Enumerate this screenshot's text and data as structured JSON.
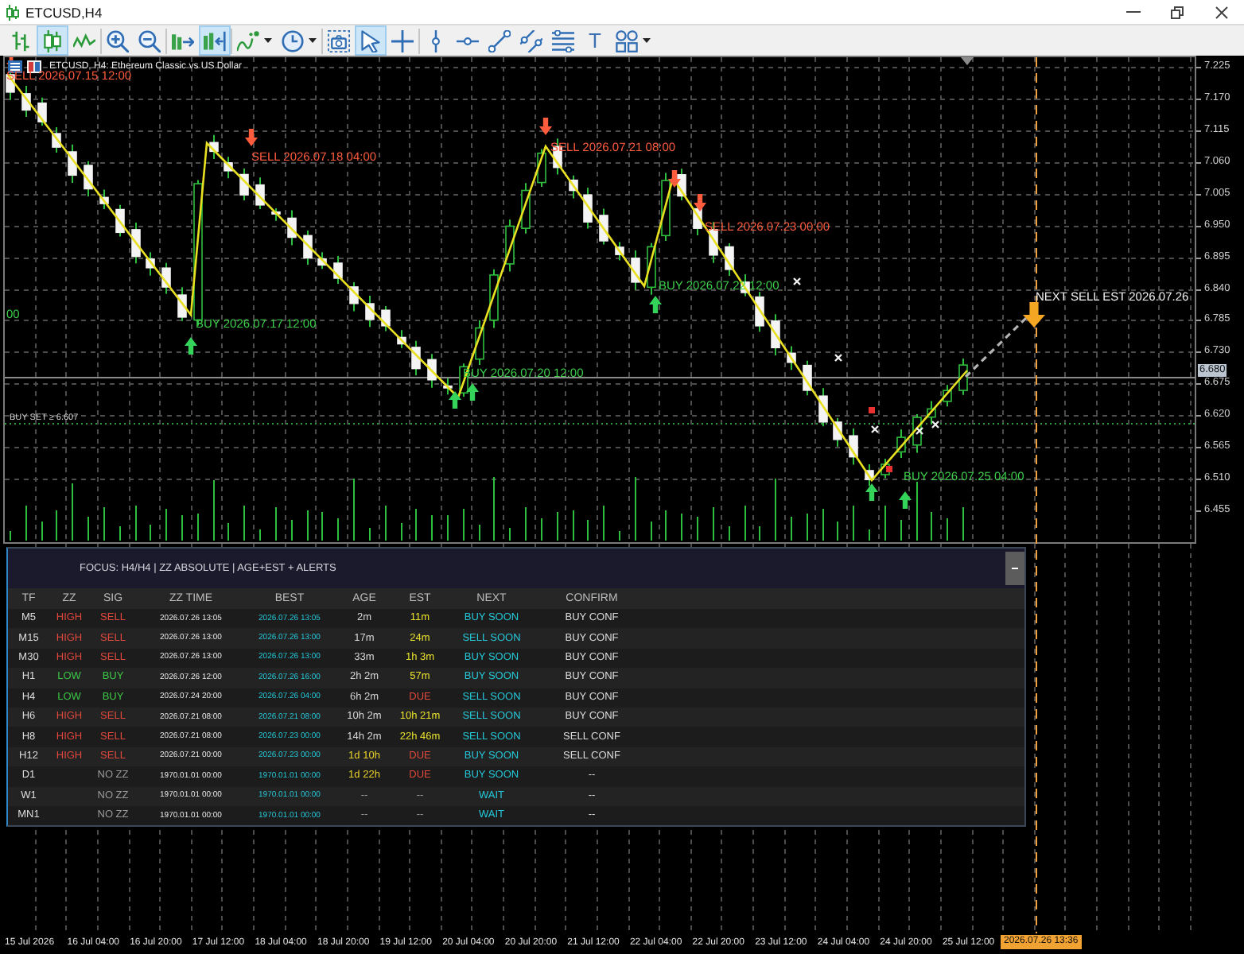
{
  "window": {
    "title": "ETCUSD,H4"
  },
  "toolbar": {
    "groups": [
      [
        {
          "kind": "bar-chart",
          "selected": false
        },
        {
          "kind": "candlesticks",
          "selected": true
        },
        {
          "kind": "line-chart",
          "selected": false
        }
      ],
      [
        {
          "kind": "zoom-in",
          "selected": false
        },
        {
          "kind": "zoom-out",
          "selected": false
        }
      ],
      [
        {
          "kind": "auto-scroll",
          "selected": false
        },
        {
          "kind": "chart-shift",
          "selected": true
        }
      ],
      [
        {
          "kind": "indicators",
          "selected": false
        },
        {
          "kind": "periods",
          "selected": false
        }
      ],
      [
        {
          "kind": "screenshot",
          "selected": false
        },
        {
          "kind": "cursor",
          "selected": true
        },
        {
          "kind": "crosshair",
          "selected": false
        }
      ],
      [
        {
          "kind": "vertical-line",
          "selected": false
        },
        {
          "kind": "horizontal-line",
          "selected": false
        },
        {
          "kind": "trendline",
          "selected": false
        },
        {
          "kind": "channel",
          "selected": false
        },
        {
          "kind": "fibonacci",
          "selected": false
        },
        {
          "kind": "text",
          "label": "T",
          "selected": false
        },
        {
          "kind": "shapes",
          "selected": false
        }
      ]
    ]
  },
  "chart": {
    "symbol": "ETCUSD, H4: Ethereum Classic vs US Dollar",
    "signals": [
      {
        "kind": "sell",
        "text": "SELL 2026.07.15 12:00"
      },
      {
        "kind": "buy",
        "text": "BUY 2026.07.17 12:00"
      },
      {
        "kind": "sell",
        "text": "SELL 2026.07.18 04:00"
      },
      {
        "kind": "buy",
        "text": "BUY 2026.07.20 12:00"
      },
      {
        "kind": "sell",
        "text": "SELL 2026.07.21 08:00"
      },
      {
        "kind": "buy",
        "text": "BUY 2026.07.22 12:00"
      },
      {
        "kind": "sell",
        "text": "SELL 2026.07.23 00:00"
      },
      {
        "kind": "buy",
        "text": "BUY 2026.07.25 04:00"
      }
    ],
    "forecast": "NEXT SELL EST 2026.07.26",
    "edge_label": "00",
    "level_label": "BUY SET ≥ 6.607",
    "price_axis": [
      "7.225",
      "7.170",
      "7.115",
      "7.060",
      "7.005",
      "6.950",
      "6.895",
      "6.840",
      "6.785",
      "6.730",
      "6.675",
      "6.620",
      "6.565",
      "6.510",
      "6.455"
    ],
    "current_price": "6.680",
    "time_axis": [
      "15 Jul 2026",
      "16 Jul 04:00",
      "16 Jul 20:00",
      "17 Jul 12:00",
      "18 Jul 04:00",
      "18 Jul 20:00",
      "19 Jul 12:00",
      "20 Jul 04:00",
      "20 Jul 20:00",
      "21 Jul 12:00",
      "22 Jul 04:00",
      "22 Jul 20:00",
      "23 Jul 12:00",
      "24 Jul 04:00",
      "24 Jul 20:00",
      "25 Jul 12:00"
    ],
    "current_time": "2026.07.26 13:36"
  },
  "panel": {
    "title": "FOCUS: H4/H4 | ZZ ABSOLUTE | AGE+EST + ALERTS",
    "columns": [
      "TF",
      "ZZ",
      "SIG",
      "ZZ TIME",
      "BEST",
      "AGE",
      "EST",
      "NEXT",
      "CONFIRM"
    ],
    "rows": [
      {
        "tf": "M5",
        "zz": {
          "text": "HIGH",
          "color": "#e2483c"
        },
        "sig": {
          "text": "SELL",
          "color": "#e2483c"
        },
        "zz_time": "2026.07.26 13:05",
        "best": "2026.07.26 13:05",
        "age": {
          "text": "2m",
          "color": "#d6d6d6"
        },
        "est": {
          "text": "11m",
          "color": "#e8e02c"
        },
        "next": "BUY SOON",
        "confirm": "BUY CONF"
      },
      {
        "tf": "M15",
        "zz": {
          "text": "HIGH",
          "color": "#e2483c"
        },
        "sig": {
          "text": "SELL",
          "color": "#e2483c"
        },
        "zz_time": "2026.07.26 13:00",
        "best": "2026.07.26 13:00",
        "age": {
          "text": "17m",
          "color": "#d6d6d6"
        },
        "est": {
          "text": "24m",
          "color": "#e8e02c"
        },
        "next": "SELL SOON",
        "confirm": "BUY CONF"
      },
      {
        "tf": "M30",
        "zz": {
          "text": "HIGH",
          "color": "#e2483c"
        },
        "sig": {
          "text": "SELL",
          "color": "#e2483c"
        },
        "zz_time": "2026.07.26 13:00",
        "best": "2026.07.26 13:00",
        "age": {
          "text": "33m",
          "color": "#d6d6d6"
        },
        "est": {
          "text": "1h 3m",
          "color": "#e8e02c"
        },
        "next": "BUY SOON",
        "confirm": "BUY CONF"
      },
      {
        "tf": "H1",
        "zz": {
          "text": "LOW",
          "color": "#3cc846"
        },
        "sig": {
          "text": "BUY",
          "color": "#3cc846"
        },
        "zz_time": "2026.07.26 12:00",
        "best": "2026.07.26 16:00",
        "age": {
          "text": "2h 2m",
          "color": "#d6d6d6"
        },
        "est": {
          "text": "57m",
          "color": "#e8e02c"
        },
        "next": "BUY SOON",
        "confirm": "BUY CONF"
      },
      {
        "tf": "H4",
        "zz": {
          "text": "LOW",
          "color": "#3cc846"
        },
        "sig": {
          "text": "BUY",
          "color": "#3cc846"
        },
        "zz_time": "2026.07.24 20:00",
        "best": "2026.07.26 04:00",
        "age": {
          "text": "6h 2m",
          "color": "#d6d6d6"
        },
        "est": {
          "text": "DUE",
          "color": "#e2483c"
        },
        "next": "SELL SOON",
        "confirm": "BUY CONF"
      },
      {
        "tf": "H6",
        "zz": {
          "text": "HIGH",
          "color": "#e2483c"
        },
        "sig": {
          "text": "SELL",
          "color": "#e2483c"
        },
        "zz_time": "2026.07.21 08:00",
        "best": "2026.07.21 08:00",
        "age": {
          "text": "10h 2m",
          "color": "#d6d6d6"
        },
        "est": {
          "text": "10h 21m",
          "color": "#e8e02c"
        },
        "next": "SELL SOON",
        "confirm": "BUY CONF"
      },
      {
        "tf": "H8",
        "zz": {
          "text": "HIGH",
          "color": "#e2483c"
        },
        "sig": {
          "text": "SELL",
          "color": "#e2483c"
        },
        "zz_time": "2026.07.21 08:00",
        "best": "2026.07.23 00:00",
        "age": {
          "text": "14h 2m",
          "color": "#d6d6d6"
        },
        "est": {
          "text": "22h 46m",
          "color": "#e8e02c"
        },
        "next": "SELL SOON",
        "confirm": "SELL CONF"
      },
      {
        "tf": "H12",
        "zz": {
          "text": "HIGH",
          "color": "#e2483c"
        },
        "sig": {
          "text": "SELL",
          "color": "#e2483c"
        },
        "zz_time": "2026.07.21 00:00",
        "best": "2026.07.23 00:00",
        "age": {
          "text": "1d 10h",
          "color": "#e8d02c"
        },
        "est": {
          "text": "DUE",
          "color": "#e2483c"
        },
        "next": "BUY SOON",
        "confirm": "SELL CONF"
      },
      {
        "tf": "D1",
        "sig": {
          "text": "NO ZZ",
          "color": "#9a9a9a"
        },
        "zz_time": "1970.01.01 00:00",
        "best": "1970.01.01 00:00",
        "age": {
          "text": "1d 22h",
          "color": "#e8d02c"
        },
        "est": {
          "text": "DUE",
          "color": "#e2483c"
        },
        "next": "BUY SOON",
        "confirm": "--"
      },
      {
        "tf": "W1",
        "sig": {
          "text": "NO ZZ",
          "color": "#9a9a9a"
        },
        "zz_time": "1970.01.01 00:00",
        "best": "1970.01.01 00:00",
        "age": {
          "text": "--",
          "color": "#9a9a9a"
        },
        "est": {
          "text": "--",
          "color": "#9a9a9a"
        },
        "next": "WAIT",
        "confirm": "--"
      },
      {
        "tf": "MN1",
        "sig": {
          "text": "NO ZZ",
          "color": "#9a9a9a"
        },
        "zz_time": "1970.01.01 00:00",
        "best": "1970.01.01 00:00",
        "age": {
          "text": "--",
          "color": "#9a9a9a"
        },
        "est": {
          "text": "--",
          "color": "#9a9a9a"
        },
        "next": "WAIT",
        "confirm": "--"
      }
    ]
  }
}
